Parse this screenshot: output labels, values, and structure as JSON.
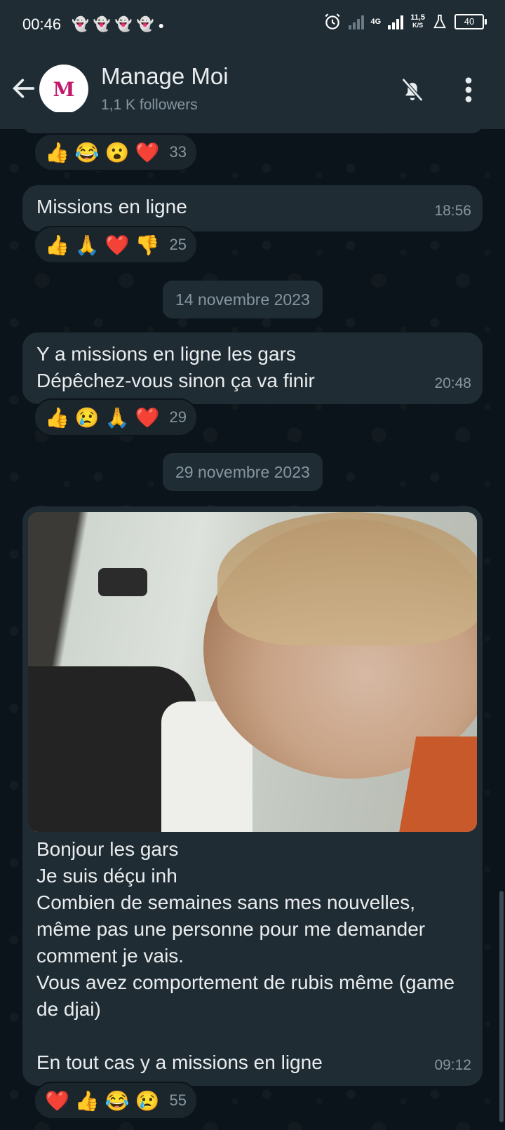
{
  "status_bar": {
    "time": "00:46",
    "notification_icons": [
      "snapchat-icon",
      "snapchat-icon",
      "snapchat-icon",
      "snapchat-icon",
      "dot-icon"
    ],
    "network_label": "4G",
    "speed_value": "11,5",
    "speed_unit": "K/S",
    "battery": "40"
  },
  "header": {
    "channel_name": "Manage Moi",
    "followers": "1,1 K followers",
    "avatar_letter": "M"
  },
  "messages": [
    {
      "reactions": {
        "emojis": [
          "👍",
          "😂",
          "😮",
          "❤️"
        ],
        "count": "33"
      }
    },
    {
      "text": "Missions en ligne",
      "time": "18:56",
      "reactions": {
        "emojis": [
          "👍",
          "🙏",
          "❤️",
          "👎"
        ],
        "count": "25"
      }
    },
    {
      "date_chip": "14 novembre 2023"
    },
    {
      "text": "Y a missions en ligne les gars\nDépêchez-vous sinon ça va finir",
      "time": "20:48",
      "reactions": {
        "emojis": [
          "👍",
          "😢",
          "🙏",
          "❤️"
        ],
        "count": "29"
      }
    },
    {
      "date_chip": "29 novembre 2023"
    },
    {
      "text": "Bonjour les gars\nJe suis déçu inh\nCombien de semaines sans mes nouvelles, même pas une personne pour me demander comment je vais.\nVous avez comportement de rubis même (game de djai)\n\nEn tout cas y a missions en ligne",
      "time": "09:12",
      "reactions": {
        "emojis": [
          "❤️",
          "👍",
          "😂",
          "😢"
        ],
        "count": "55"
      }
    }
  ],
  "colors": {
    "background": "#0b141a",
    "bar": "#1f2c34",
    "bubble": "#202c33",
    "muted_text": "#8696a0"
  }
}
